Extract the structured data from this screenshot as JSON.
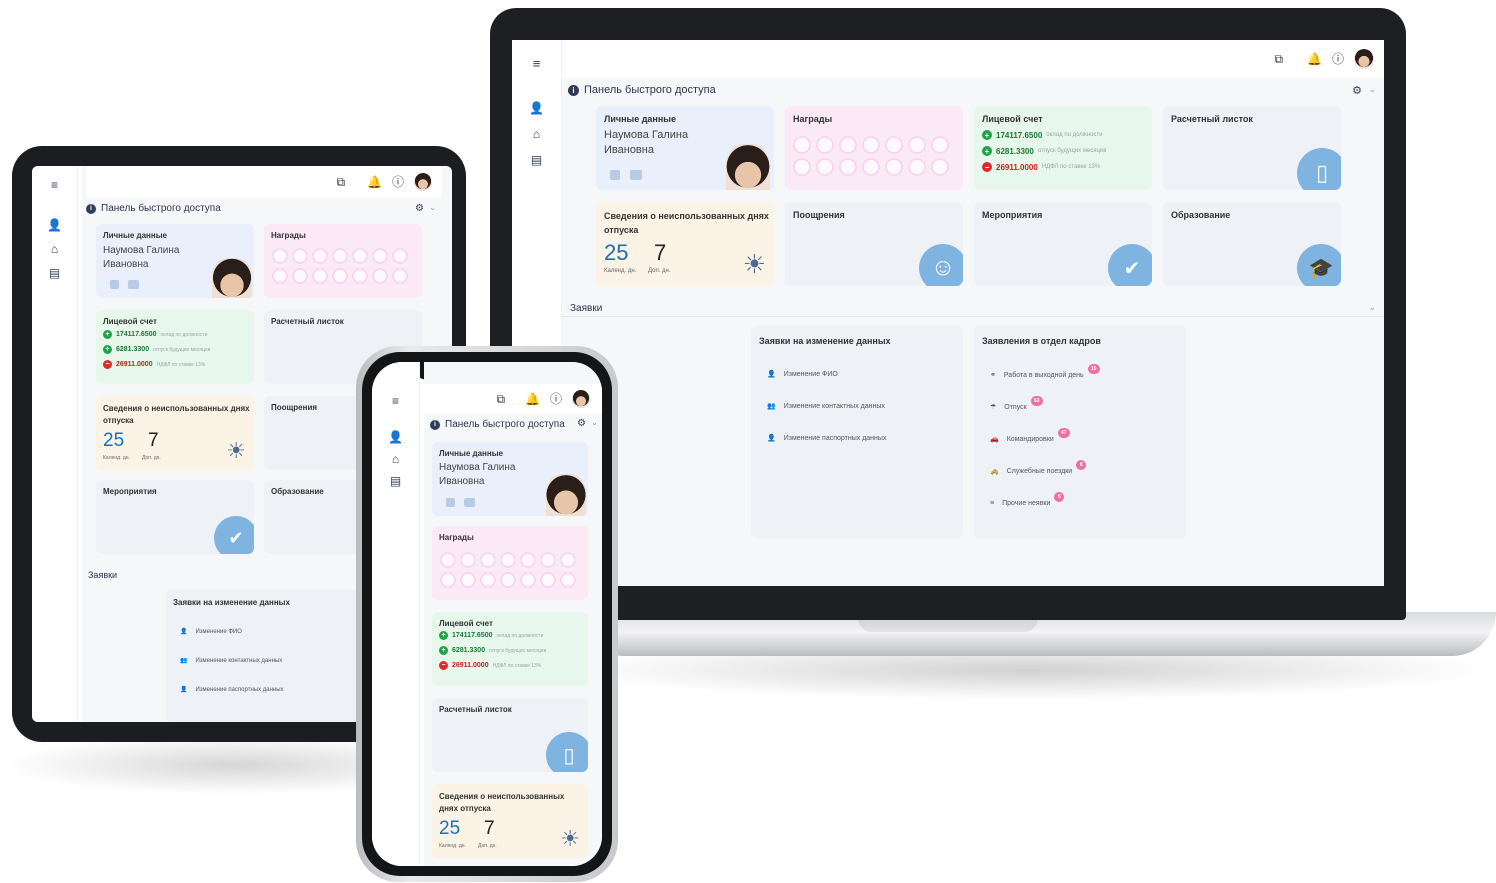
{
  "colors": {
    "accent": "#1b6fb8",
    "positive": "#21a148",
    "negative": "#e02a2a",
    "badge": "#ef6fa0",
    "icon_blob": "#7fb3e0"
  },
  "icons": {
    "menu": "hamburger-icon",
    "user": "user-edit-icon",
    "tree": "org-structure-icon",
    "card": "id-card-icon",
    "window": "window-icon",
    "bell": "bell-icon",
    "help": "help-icon",
    "gear": "gear-icon",
    "chevron": "chevron-down-icon",
    "document": "document-icon",
    "smile": "smile-icon",
    "calendar": "calendar-check-icon",
    "graduate": "graduate-icon",
    "sun": "sunset-icon"
  },
  "dashboard": {
    "quick_panel": "Панель быстрого доступа",
    "personal": {
      "title": "Личные данные",
      "surname_name": "Наумова Галина",
      "patronymic": "Ивановна"
    },
    "awards": {
      "title": "Награды"
    },
    "account": {
      "title": "Лицевой счет",
      "rows": [
        {
          "sign": "+",
          "amount": "174117.6500",
          "note": "оклад по должности"
        },
        {
          "sign": "+",
          "amount": "6281.3300",
          "note": "отпуск будущих месяцев"
        },
        {
          "sign": "−",
          "amount": "26911.0000",
          "note": "НДФЛ по ставке 13%"
        }
      ]
    },
    "payslip": {
      "title": "Расчетный листок"
    },
    "vacation": {
      "title": "Сведения о неиспользованных днях отпуска",
      "title_phone_1": "Сведения о неиспользованных",
      "title_phone_2": "днях отпуска",
      "cal_days": "25",
      "extra_days": "7",
      "cal_label": "Календ. дн.",
      "extra_label": "Доп. дн."
    },
    "incentives": {
      "title": "Поощрения"
    },
    "events": {
      "title": "Мероприятия"
    },
    "education": {
      "title": "Образование"
    },
    "requests": {
      "title": "Заявки",
      "data_changes": {
        "title": "Заявки на изменение данных",
        "items": [
          "Изменение ФИО",
          "Изменение контактных данных",
          "Изменение паспортных данных"
        ]
      },
      "hr": {
        "title": "Заявления в отдел кадров",
        "items": [
          {
            "label": "Работа в выходной день",
            "count": "15"
          },
          {
            "label": "Отпуск",
            "count": "63"
          },
          {
            "label": "Командировки",
            "count": "47"
          },
          {
            "label": "Служебные поездки",
            "count": "8"
          },
          {
            "label": "Прочие неявки",
            "count": "5"
          }
        ]
      }
    }
  }
}
